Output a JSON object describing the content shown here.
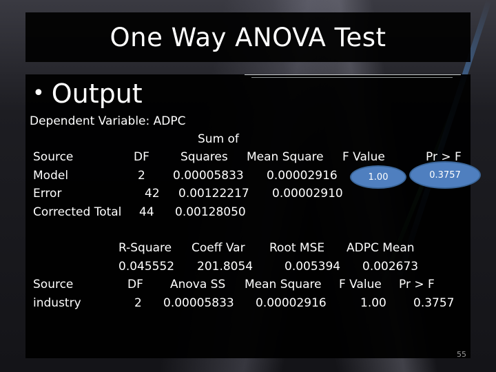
{
  "slide": {
    "title": "One Way ANOVA Test",
    "bullet": "Output",
    "page_number": "55"
  },
  "anova_table": {
    "dependent_variable_label": "Dependent Variable: ADPC",
    "header_top": {
      "sum_of": "Sum of"
    },
    "headers": {
      "source": "Source",
      "df": "DF",
      "squares": "Squares",
      "mean_square": "Mean Square",
      "f_value": "F Value",
      "pr_f": "Pr > F"
    },
    "rows": [
      {
        "source": "Model",
        "df": "2",
        "ss": "0.00005833",
        "ms": "0.00002916",
        "f": "1.00",
        "p": "0.3757"
      },
      {
        "source": "Error",
        "df": "42",
        "ss": "0.00122217",
        "ms": "0.00002910"
      },
      {
        "source": "Corrected Total",
        "df": "44",
        "ss": "0.00128050"
      }
    ]
  },
  "fit_stats": {
    "headers": {
      "r_square": "R-Square",
      "coeff_var": "Coeff Var",
      "root_mse": "Root MSE",
      "mean": "ADPC Mean"
    },
    "values": {
      "r_square": "0.045552",
      "coeff_var": "201.8054",
      "root_mse": "0.005394",
      "mean": "0.002673"
    }
  },
  "type_ss": {
    "headers": {
      "source": "Source",
      "df": "DF",
      "anova_ss": "Anova SS",
      "mean_square": "Mean Square",
      "f_value": "F Value",
      "pr_f": "Pr > F"
    },
    "row": {
      "source": "industry",
      "df": "2",
      "anova_ss": "0.00005833",
      "mean_square": "0.00002916",
      "f_value": "1.00",
      "pr_f": "0.3757"
    }
  },
  "highlight_color": "#4f7fbf"
}
